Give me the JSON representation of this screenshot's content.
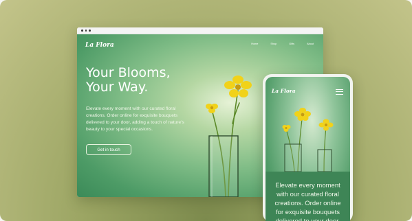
{
  "desktop": {
    "brand": "La Flora",
    "nav": [
      "Home",
      "Shop",
      "Gifts",
      "About"
    ],
    "hero": {
      "title_line1": "Your Blooms,",
      "title_line2": "Your Way.",
      "text": "Elevate every moment with our curated floral creations. Order online for exquisite bouquets delivered to your door, adding a touch of nature's beauty to your special occasions.",
      "cta": "Get in touch"
    }
  },
  "mobile": {
    "brand": "La Flora",
    "panel_text": "Elevate every moment with our curated floral creations. Order online for exquisite bouquets delivered to your door,"
  },
  "colors": {
    "background": "#c3c48a",
    "site_green": "#4d9b66",
    "flower_yellow": "#f2d21e",
    "stem_green": "#5f8f2c"
  }
}
